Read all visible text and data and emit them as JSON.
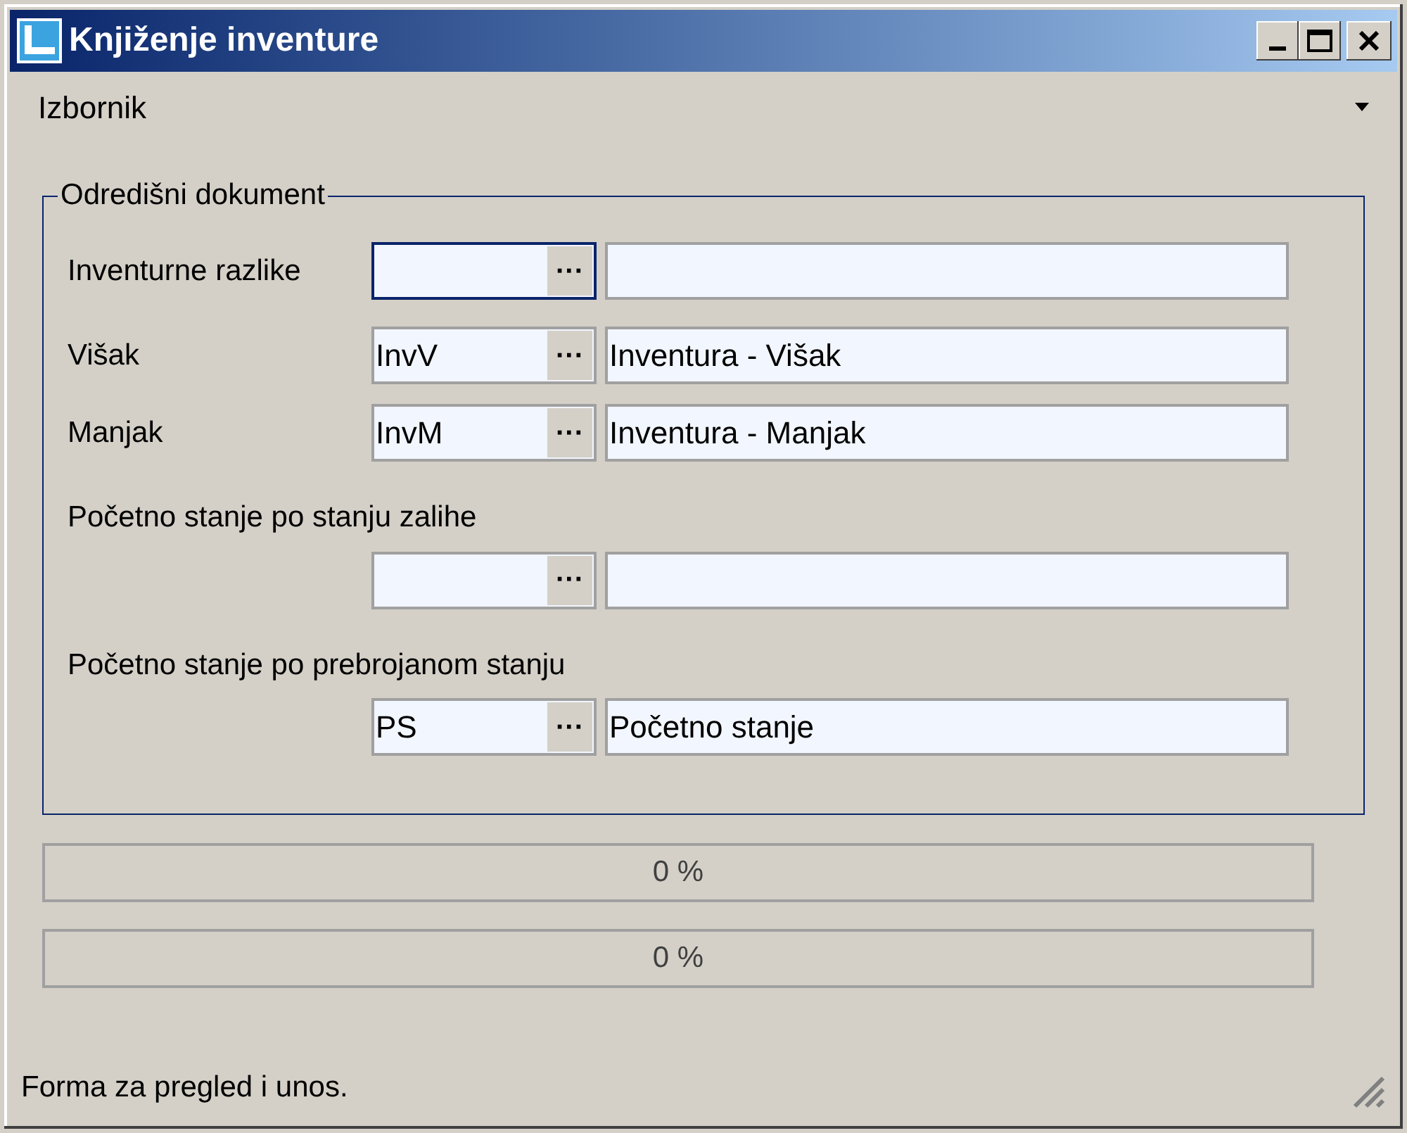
{
  "window": {
    "title": "Knjiženje inventure"
  },
  "menu": {
    "label": "Izbornik"
  },
  "group": {
    "title": "Odredišni dokument",
    "rows": [
      {
        "kind": "inline",
        "label": "Inventurne razlike",
        "code": "",
        "name": "",
        "focused": true
      },
      {
        "kind": "inline",
        "label": "Višak",
        "code": "InvV",
        "name": "Inventura - Višak",
        "focused": false
      },
      {
        "kind": "inline",
        "label": "Manjak",
        "code": "InvM",
        "name": "Inventura - Manjak",
        "focused": false
      },
      {
        "kind": "stacked",
        "label": "Početno stanje po stanju zalihe",
        "code": "",
        "name": "",
        "focused": false
      },
      {
        "kind": "stacked",
        "label": "Početno stanje po prebrojanom stanju",
        "code": "PS",
        "name": "Početno stanje",
        "focused": false
      }
    ],
    "lookup_button": "···"
  },
  "progress": [
    {
      "level": 0,
      "reading": "0 %"
    },
    {
      "level": 0,
      "reading": "0 %"
    }
  ],
  "status_bar": {
    "text": "Forma za pregled i unos."
  }
}
